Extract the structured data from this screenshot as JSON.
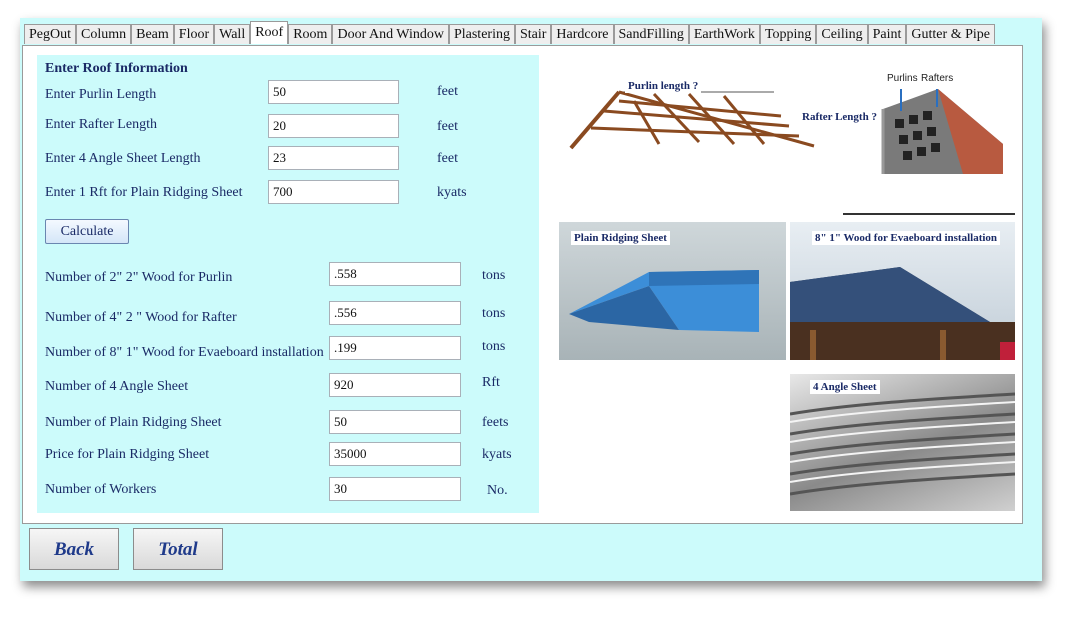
{
  "tabs": [
    "PegOut",
    "Column",
    "Beam",
    "Floor",
    "Wall",
    "Roof",
    "Room",
    "Door And Window",
    "Plastering",
    "Stair",
    "Hardcore",
    "SandFilling",
    "EarthWork",
    "Topping",
    "Ceiling",
    "Paint",
    "Gutter & Pipe"
  ],
  "active_tab": "Roof",
  "form": {
    "heading": "Enter Roof Information",
    "purlin_label": "Enter Purlin Length",
    "purlin_value": "50",
    "purlin_unit": "feet",
    "rafter_label": "Enter Rafter Length",
    "rafter_value": "20",
    "rafter_unit": "feet",
    "angle_label": "Enter 4 Angle Sheet Length",
    "angle_value": "23",
    "angle_unit": "feet",
    "ridging_rate_label": "Enter 1 Rft for Plain Ridging Sheet",
    "ridging_rate_value": "700",
    "ridging_rate_unit": "kyats",
    "calculate_label": "Calculate"
  },
  "results": {
    "purlin_wood_label": "Number of 2\" 2\" Wood for Purlin",
    "purlin_wood_value": ".558",
    "purlin_wood_unit": "tons",
    "rafter_wood_label": "Number of 4\" 2 \" Wood for Rafter",
    "rafter_wood_value": ".556",
    "rafter_wood_unit": "tons",
    "evaeboard_label": "Number of 8\" 1\" Wood for Evaeboard installation",
    "evaeboard_value": ".199",
    "evaeboard_unit": "tons",
    "angle_sheet_label": "Number of 4 Angle Sheet",
    "angle_sheet_value": "920",
    "angle_sheet_unit": "Rft",
    "ridging_count_label": "Number of Plain Ridging Sheet",
    "ridging_count_value": "50",
    "ridging_count_unit": "feets",
    "ridging_price_label": "Price for Plain Ridging Sheet",
    "ridging_price_value": "35000",
    "ridging_price_unit": "kyats",
    "workers_label": "Number of Workers",
    "workers_value": "30",
    "workers_unit": "No."
  },
  "images": {
    "purlin_caption": "Purlin length ?",
    "rafter_caption": "Rafter Length ?",
    "purlins_tag": "Purlins",
    "rafters_tag": "Rafters",
    "ridging_caption": "Plain Ridging Sheet",
    "evaeboard_caption": "8\" 1\" Wood for Evaeboard installation",
    "angle_caption": "4 Angle Sheet"
  },
  "footer": {
    "back_label": "Back",
    "total_label": "Total"
  }
}
